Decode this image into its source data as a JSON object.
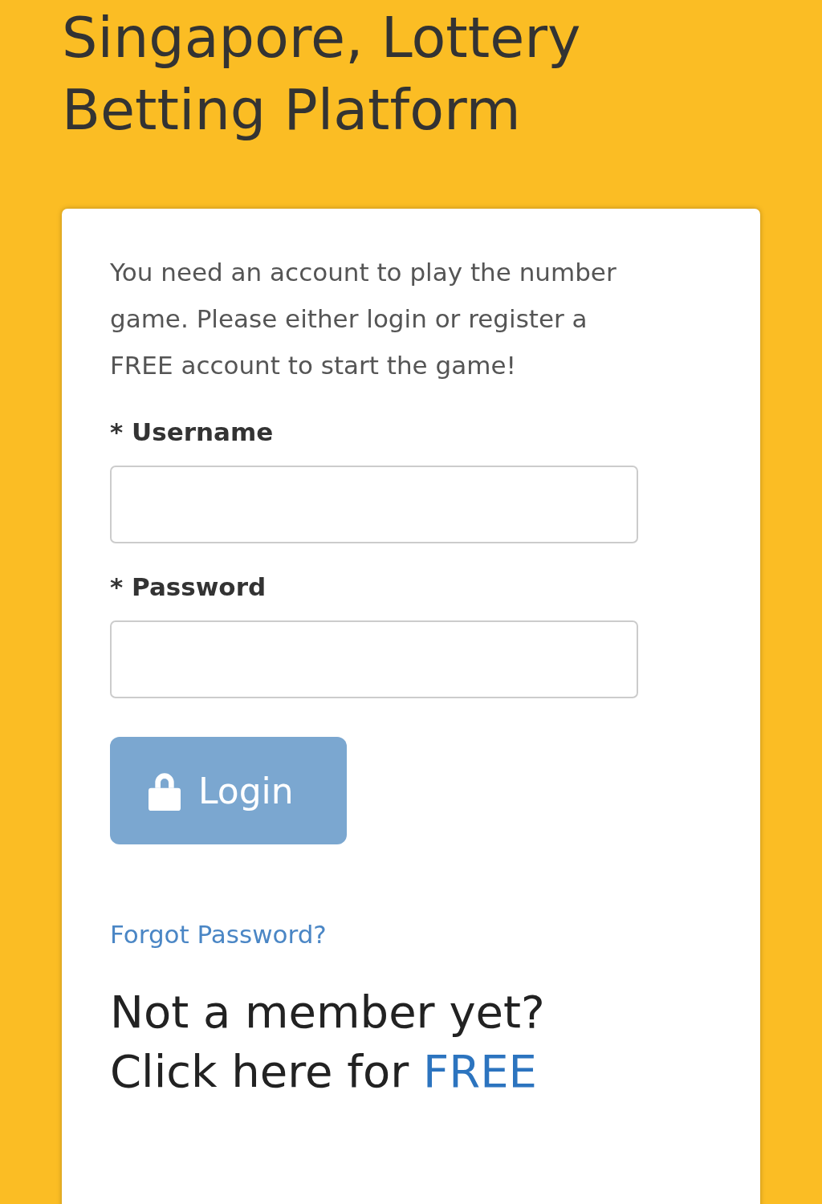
{
  "heading": [
    "Singapore, Lottery",
    "Betting Platform"
  ],
  "login_card": {
    "intro": "You need an account to play the number game. Please either login or register a FREE account to start the game!",
    "fields": [
      {
        "label": "* Username"
      },
      {
        "label": "* Password"
      }
    ],
    "login_button": {
      "label": "Login",
      "disabled": true
    },
    "forgot_link": "Forgot Password?",
    "signup_prompt": "Not a member yet?",
    "signup_lead": "Click here for ",
    "signup_link": "FREE"
  }
}
